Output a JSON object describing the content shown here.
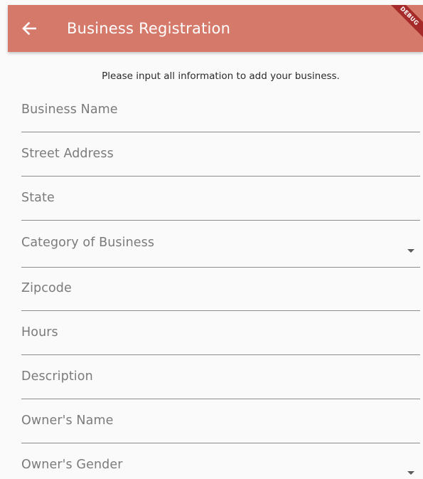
{
  "app_bar": {
    "title": "Business Registration",
    "back_icon": "arrow-left-icon",
    "debug_banner": "DEBUG",
    "color": "#d57a6b"
  },
  "form": {
    "intro": "Please input all information to add your business.",
    "fields": [
      {
        "label": "Business Name",
        "type": "text"
      },
      {
        "label": "Street Address",
        "type": "text"
      },
      {
        "label": "State",
        "type": "text"
      },
      {
        "label": "Category of Business",
        "type": "dropdown",
        "icon": "dropdown-arrow-icon"
      },
      {
        "label": "Zipcode",
        "type": "text"
      },
      {
        "label": "Hours",
        "type": "text"
      },
      {
        "label": "Description",
        "type": "text"
      },
      {
        "label": "Owner's Name",
        "type": "text"
      },
      {
        "label": "Owner's Gender",
        "type": "dropdown",
        "icon": "dropdown-arrow-icon"
      }
    ]
  }
}
